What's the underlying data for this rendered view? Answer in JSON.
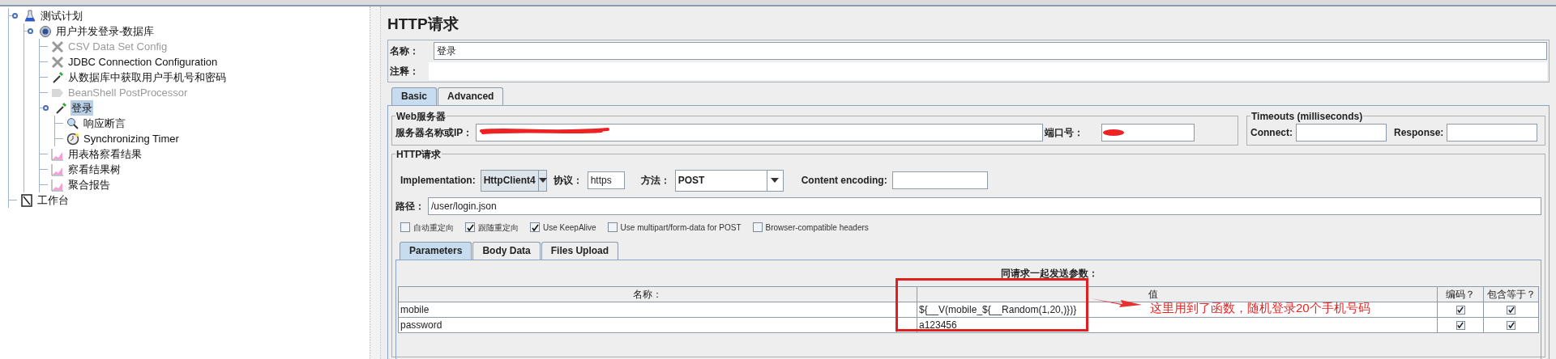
{
  "tree": [
    {
      "label": "测试计划",
      "kind": "test-plan",
      "disabled": false,
      "selected": false,
      "expanded": true,
      "children": [
        {
          "label": "用户并发登录-数据库",
          "kind": "thread-group",
          "disabled": false,
          "selected": false,
          "expanded": true,
          "children": [
            {
              "label": "CSV Data Set Config",
              "kind": "config",
              "disabled": true,
              "selected": false
            },
            {
              "label": "JDBC Connection Configuration",
              "kind": "config",
              "disabled": false,
              "selected": false
            },
            {
              "label": "从数据库中获取用户手机号和密码",
              "kind": "sampler",
              "disabled": false,
              "selected": false
            },
            {
              "label": "BeanShell PostProcessor",
              "kind": "post-processor",
              "disabled": true,
              "selected": false
            },
            {
              "label": "登录",
              "kind": "sampler",
              "disabled": false,
              "selected": true,
              "expanded": true,
              "children": [
                {
                  "label": "响应断言",
                  "kind": "assertion",
                  "disabled": false,
                  "selected": false
                },
                {
                  "label": "Synchronizing Timer",
                  "kind": "timer",
                  "disabled": false,
                  "selected": false
                }
              ]
            },
            {
              "label": "用表格察看结果",
              "kind": "listener",
              "disabled": false,
              "selected": false
            },
            {
              "label": "察看结果树",
              "kind": "listener",
              "disabled": false,
              "selected": false
            },
            {
              "label": "聚合报告",
              "kind": "listener",
              "disabled": false,
              "selected": false
            }
          ]
        }
      ]
    },
    {
      "label": "工作台",
      "kind": "workbench",
      "disabled": false,
      "selected": false
    }
  ],
  "panel": {
    "title": "HTTP请求",
    "name": {
      "label": "名称：",
      "value": "登录"
    },
    "comment": {
      "label": "注释："
    },
    "tabs": [
      {
        "label": "Basic",
        "selected": true
      },
      {
        "label": "Advanced",
        "selected": false
      }
    ],
    "web_server": {
      "title": "Web服务器",
      "server_label": "服务器名称或IP：",
      "port_label": "端口号："
    },
    "timeouts": {
      "title": "Timeouts (milliseconds)",
      "connect_label": "Connect:",
      "response_label": "Response:"
    },
    "http_request": {
      "title": "HTTP请求",
      "implementation_label": "Implementation:",
      "implementation": "HttpClient4",
      "protocol_label": "协议：",
      "protocol": "https",
      "method_label": "方法：",
      "method": "POST",
      "encoding_label": "Content encoding:",
      "path_label": "路径：",
      "path": "/user/login.json",
      "options": [
        {
          "label": "自动重定向",
          "checked": false
        },
        {
          "label": "跟随重定向",
          "checked": true
        },
        {
          "label": "Use KeepAlive",
          "checked": true
        },
        {
          "label": "Use multipart/form-data for POST",
          "checked": false
        },
        {
          "label": "Browser-compatible headers",
          "checked": false
        }
      ]
    },
    "sub_tabs": [
      {
        "label": "Parameters",
        "selected": true
      },
      {
        "label": "Body Data",
        "selected": false
      },
      {
        "label": "Files Upload",
        "selected": false
      }
    ],
    "parameters": {
      "caption": "同请求一起发送参数：",
      "columns": [
        "名称：",
        "值",
        "编码？",
        "包含等于？"
      ],
      "rows": [
        {
          "name": "mobile",
          "value": "${__V(mobile_${__Random(1,20,)})}",
          "encode": true,
          "include_equals": true
        },
        {
          "name": "password",
          "value": "a123456",
          "encode": true,
          "include_equals": true
        }
      ]
    }
  },
  "annotation": {
    "text": "这里用到了函数，随机登录20个手机号码"
  }
}
